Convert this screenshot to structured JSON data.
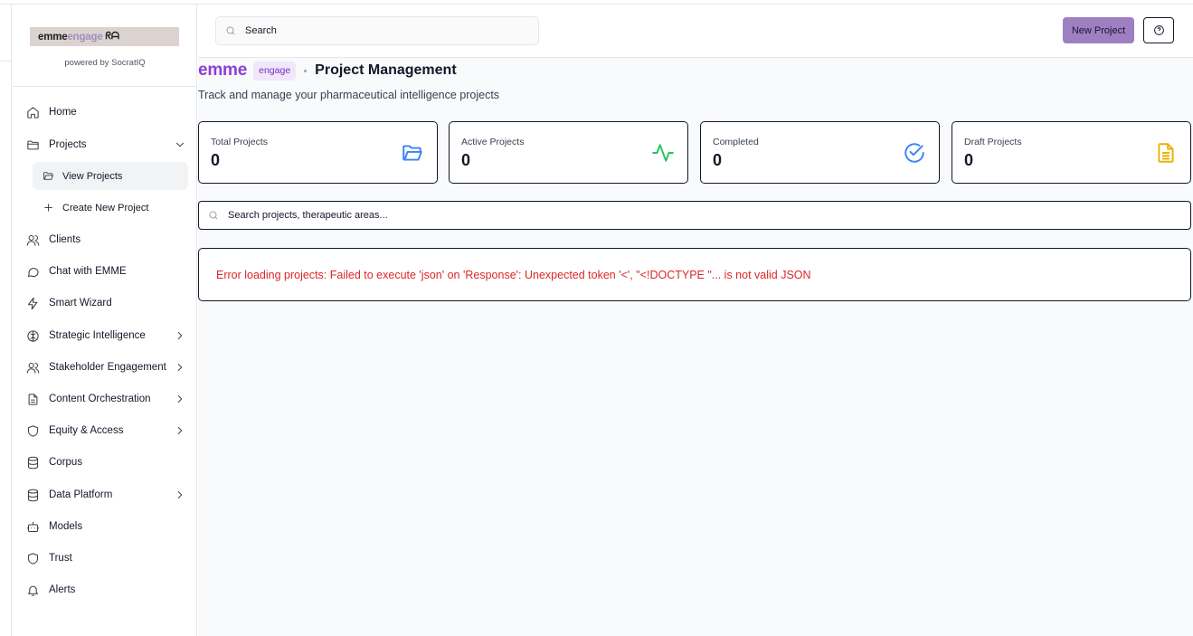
{
  "brand": {
    "logo_part1": "emme",
    "logo_part2": "engage",
    "logo_mark": "ᖇᗩ",
    "powered_by": "powered by SocratIQ"
  },
  "topbar": {
    "search_placeholder": "Search",
    "new_project_label": "New Project",
    "help_icon": "question-circle-icon"
  },
  "sidebar": {
    "items": [
      {
        "label": "Home",
        "icon": "home-icon"
      },
      {
        "label": "Projects",
        "icon": "folder-icon",
        "expanded": true
      },
      {
        "label": "View Projects",
        "icon": "folder-open-icon",
        "active": true
      },
      {
        "label": "Create New Project",
        "icon": "plus-icon"
      },
      {
        "label": "Clients",
        "icon": "users-icon"
      },
      {
        "label": "Chat with EMME",
        "icon": "chat-bubble-icon"
      },
      {
        "label": "Smart Wizard",
        "icon": "lightning-icon"
      },
      {
        "label": "Strategic Intelligence",
        "icon": "brain-icon",
        "has_children": true
      },
      {
        "label": "Stakeholder Engagement",
        "icon": "users-icon",
        "has_children": true
      },
      {
        "label": "Content Orchestration",
        "icon": "document-icon",
        "has_children": true
      },
      {
        "label": "Equity & Access",
        "icon": "shield-icon",
        "has_children": true
      },
      {
        "label": "Corpus",
        "icon": "database-icon"
      },
      {
        "label": "Data Platform",
        "icon": "database-icon",
        "has_children": true
      },
      {
        "label": "Models",
        "icon": "robot-icon"
      },
      {
        "label": "Trust",
        "icon": "shield-icon"
      },
      {
        "label": "Alerts",
        "icon": "bell-icon"
      }
    ]
  },
  "main": {
    "brand_word": "emme",
    "brand_pill": "engage",
    "title": "Project Management",
    "subtitle": "Track and manage your pharmaceutical intelligence projects",
    "stats": [
      {
        "label": "Total Projects",
        "value": "0",
        "icon": "folder-open-icon",
        "color": "#3b82f6"
      },
      {
        "label": "Active Projects",
        "value": "0",
        "icon": "activity-icon",
        "color": "#22c55e"
      },
      {
        "label": "Completed",
        "value": "0",
        "icon": "check-circle-icon",
        "color": "#3b82f6"
      },
      {
        "label": "Draft Projects",
        "value": "0",
        "icon": "document-icon",
        "color": "#eab308"
      }
    ],
    "filter_placeholder": "Search projects, therapeutic areas...",
    "error_message": "Error loading projects: Failed to execute 'json' on 'Response': Unexpected token '<', \"<!DOCTYPE \"... is not valid JSON"
  },
  "colors": {
    "accent": "#9d7fc2",
    "brand_purple": "#8b3fd6",
    "error": "#dc2626"
  }
}
